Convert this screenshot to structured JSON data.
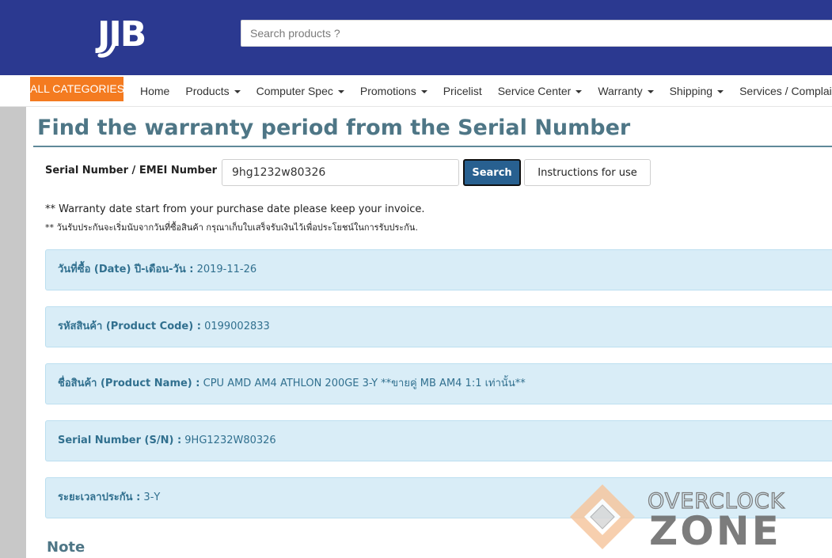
{
  "header": {
    "logo_text": "JIB",
    "search_placeholder": "Search products ?"
  },
  "nav": {
    "all_categories": "ALL CATEGORIES",
    "items": [
      {
        "label": "Home",
        "dropdown": false
      },
      {
        "label": "Products",
        "dropdown": true
      },
      {
        "label": "Computer Spec",
        "dropdown": true
      },
      {
        "label": "Promotions",
        "dropdown": true
      },
      {
        "label": "Pricelist",
        "dropdown": false
      },
      {
        "label": "Service Center",
        "dropdown": true
      },
      {
        "label": "Warranty",
        "dropdown": true
      },
      {
        "label": "Shipping",
        "dropdown": true
      },
      {
        "label": "Services / Complai",
        "dropdown": false
      }
    ]
  },
  "page": {
    "title": "Find the warranty period from the Serial Number"
  },
  "form": {
    "serial_label": "Serial Number / EMEI Number :",
    "serial_value": "9hg1232w80326",
    "search_button": "Search",
    "instructions_button": "Instructions for use"
  },
  "notes": {
    "english": "** Warranty date start from your purchase date please keep your invoice.",
    "thai": "** วันรับประกันจะเริ่มนับจากวันที่ซื้อสินค้า กรุณาเก็บใบเสร็จรับเงินไว้เพื่อประโยชน์ในการรับประกัน."
  },
  "results": [
    {
      "label": "วันที่ซื้อ (Date) ปี-เดือน-วัน :",
      "value": "2019-11-26"
    },
    {
      "label": "รหัสสินค้า (Product Code) :",
      "value": "0199002833"
    },
    {
      "label": "ชื่อสินค้า (Product Name) :",
      "value": "CPU AMD AM4 ATHLON 200GE 3-Y **ขายคู่ MB AM4 1:1 เท่านั้น**"
    },
    {
      "label": "Serial Number (S/N) :",
      "value": "9HG1232W80326"
    },
    {
      "label": "ระยะเวลาประกัน :",
      "value": "3-Y"
    }
  ],
  "note_heading": "Note",
  "watermark": {
    "line1": "OVERCLOCK",
    "line2": "ZONE"
  },
  "colors": {
    "header_blue": "#2b3990",
    "accent_orange": "#f47b20",
    "title_teal": "#4e7686",
    "info_bg": "#d9edf7",
    "info_text": "#31708f",
    "button_blue": "#286090"
  }
}
